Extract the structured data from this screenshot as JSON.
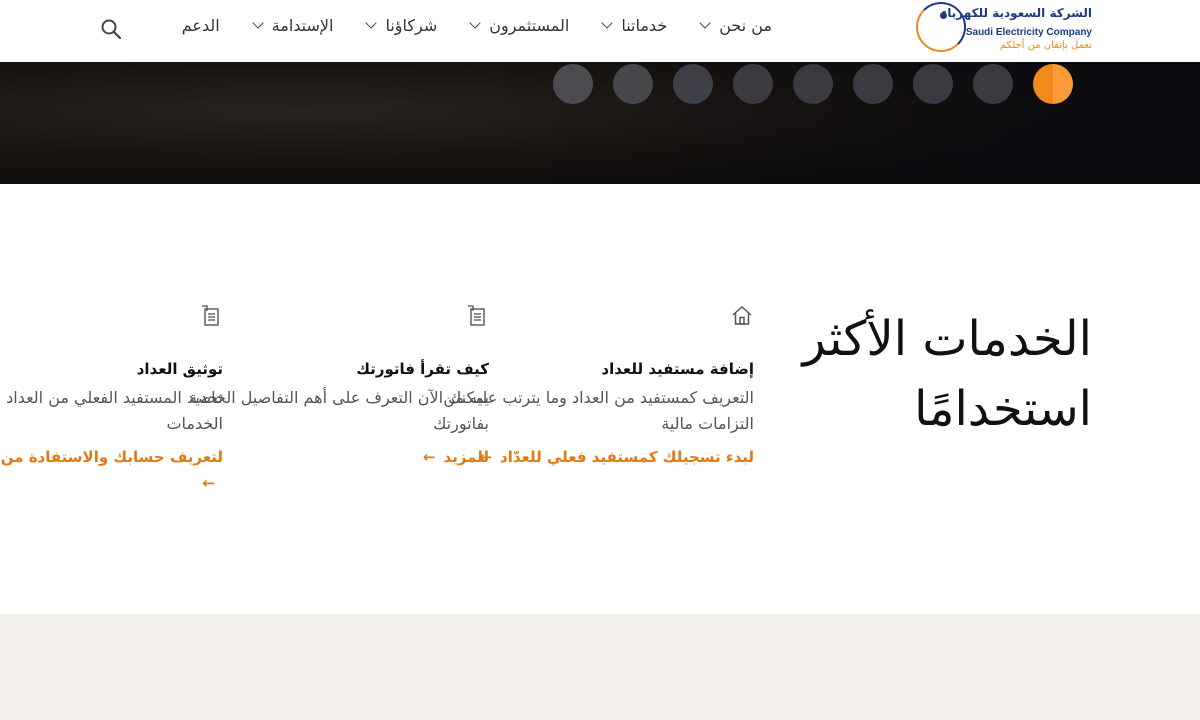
{
  "brand": {
    "name_ar": "الشركة السعودية للكهرباء",
    "name_en": "Saudi Electricity Company",
    "tagline": "نعمل بإتقان من أجلكم",
    "colors": {
      "primary": "#1b3c84",
      "accent": "#f08a1c"
    }
  },
  "nav": {
    "items": [
      {
        "label": "من نحن",
        "has_dropdown": true
      },
      {
        "label": "خدماتنا",
        "has_dropdown": true
      },
      {
        "label": "المستثمرون",
        "has_dropdown": true
      },
      {
        "label": "شركاؤنا",
        "has_dropdown": true
      },
      {
        "label": "الإستدامة",
        "has_dropdown": true
      },
      {
        "label": "الدعم",
        "has_dropdown": false
      }
    ],
    "search_icon": "search-icon"
  },
  "hero": {
    "slide_count": 9,
    "active_slide": 1
  },
  "services": {
    "title": "الخدمات الأكثر استخدامًا",
    "cards": [
      {
        "icon": "house-icon",
        "title": "إضافة مستفيد للعداد",
        "description": "التعريف كمستفيد من العداد وما يترتب عليه من التزامات مالية",
        "link": "لبدء تسجيلك كمستفيد فعلي للعدّاد"
      },
      {
        "icon": "document-icon",
        "title": "كيف تقرأ فاتورتك",
        "description": "يمكنك الآن التعرف على أهم التفاصيل الخاصة بفاتورتك",
        "link": "للمزيد"
      },
      {
        "icon": "document-icon",
        "title": "توثيق العداد",
        "description": "تحديد المستفيد الفعلي من العداد والاستفادة من الخدمات",
        "link": "لتعريف حسابك والاستفادة من كافة الخدمات"
      }
    ],
    "arrow": "←"
  }
}
